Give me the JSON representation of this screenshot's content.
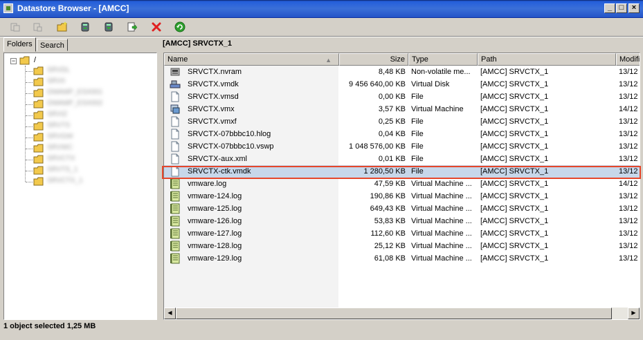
{
  "window": {
    "title": "Datastore Browser - [AMCC]",
    "controls": [
      "_",
      "□",
      "×"
    ]
  },
  "toolbar": {
    "buttons": [
      {
        "name": "upload-disabled-icon"
      },
      {
        "name": "download-disabled-icon"
      },
      {
        "name": "new-folder-icon"
      },
      {
        "name": "upload-to-datastore-icon"
      },
      {
        "name": "download-from-datastore-icon"
      },
      {
        "name": "move-icon"
      },
      {
        "name": "delete-icon",
        "color": "#e02020"
      },
      {
        "name": "refresh-icon",
        "color": "#2fa02f"
      }
    ]
  },
  "tabs": [
    {
      "label": "Folders"
    },
    {
      "label": "Search"
    }
  ],
  "tree": {
    "root": "/",
    "items": [
      "SRVDL",
      "SRVII",
      "DWAMP_ESX001",
      "DWAMP_ESX002",
      "SRVIZ",
      "SRVTS",
      "SRVGW",
      "SRVWC",
      "SRVCTX",
      "SRVTS_1",
      "SRVCTX_1"
    ]
  },
  "current_path": "[AMCC] SRVCTX_1",
  "columns": [
    "Name",
    "Size",
    "Type",
    "Path",
    "Modifi"
  ],
  "files": [
    {
      "name": "SRVCTX.nvram",
      "size": "8,48 KB",
      "type": "Non-volatile me...",
      "path": "[AMCC] SRVCTX_1",
      "modified": "13/12",
      "icon": "nvram"
    },
    {
      "name": "SRVCTX.vmdk",
      "size": "9 456 640,00 KB",
      "type": "Virtual Disk",
      "path": "[AMCC] SRVCTX_1",
      "modified": "13/12",
      "icon": "vdisk"
    },
    {
      "name": "SRVCTX.vmsd",
      "size": "0,00 KB",
      "type": "File",
      "path": "[AMCC] SRVCTX_1",
      "modified": "13/12",
      "icon": "file"
    },
    {
      "name": "SRVCTX.vmx",
      "size": "3,57 KB",
      "type": "Virtual Machine",
      "path": "[AMCC] SRVCTX_1",
      "modified": "14/12",
      "icon": "vm"
    },
    {
      "name": "SRVCTX.vmxf",
      "size": "0,25 KB",
      "type": "File",
      "path": "[AMCC] SRVCTX_1",
      "modified": "13/12",
      "icon": "file"
    },
    {
      "name": "SRVCTX-07bbbc10.hlog",
      "size": "0,04 KB",
      "type": "File",
      "path": "[AMCC] SRVCTX_1",
      "modified": "13/12",
      "icon": "file"
    },
    {
      "name": "SRVCTX-07bbbc10.vswp",
      "size": "1 048 576,00 KB",
      "type": "File",
      "path": "[AMCC] SRVCTX_1",
      "modified": "13/12",
      "icon": "file"
    },
    {
      "name": "SRVCTX-aux.xml",
      "size": "0,01 KB",
      "type": "File",
      "path": "[AMCC] SRVCTX_1",
      "modified": "13/12",
      "icon": "file"
    },
    {
      "name": "SRVCTX-ctk.vmdk",
      "size": "1 280,50 KB",
      "type": "File",
      "path": "[AMCC] SRVCTX_1",
      "modified": "13/12",
      "icon": "file",
      "selected": true
    },
    {
      "name": "vmware.log",
      "size": "47,59 KB",
      "type": "Virtual Machine ...",
      "path": "[AMCC] SRVCTX_1",
      "modified": "14/12",
      "icon": "log"
    },
    {
      "name": "vmware-124.log",
      "size": "190,86 KB",
      "type": "Virtual Machine ...",
      "path": "[AMCC] SRVCTX_1",
      "modified": "13/12",
      "icon": "log"
    },
    {
      "name": "vmware-125.log",
      "size": "649,43 KB",
      "type": "Virtual Machine ...",
      "path": "[AMCC] SRVCTX_1",
      "modified": "13/12",
      "icon": "log"
    },
    {
      "name": "vmware-126.log",
      "size": "53,83 KB",
      "type": "Virtual Machine ...",
      "path": "[AMCC] SRVCTX_1",
      "modified": "13/12",
      "icon": "log"
    },
    {
      "name": "vmware-127.log",
      "size": "112,60 KB",
      "type": "Virtual Machine ...",
      "path": "[AMCC] SRVCTX_1",
      "modified": "13/12",
      "icon": "log"
    },
    {
      "name": "vmware-128.log",
      "size": "25,12 KB",
      "type": "Virtual Machine ...",
      "path": "[AMCC] SRVCTX_1",
      "modified": "13/12",
      "icon": "log"
    },
    {
      "name": "vmware-129.log",
      "size": "61,08 KB",
      "type": "Virtual Machine ...",
      "path": "[AMCC] SRVCTX_1",
      "modified": "13/12",
      "icon": "log"
    }
  ],
  "status": {
    "text": "1 object selected 1,25 MB"
  },
  "colors": {
    "selection_bg": "#c7d7ea",
    "highlight_border": "#e5462a",
    "titlebar": "#2455c8"
  }
}
